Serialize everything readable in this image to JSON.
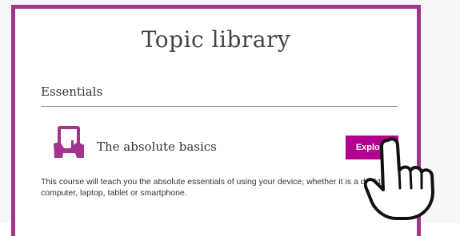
{
  "page": {
    "title": "Topic library"
  },
  "section": {
    "heading": "Essentials"
  },
  "course": {
    "title": "The absolute basics",
    "explore_label": "Explore",
    "description": "This course will teach you the absolute essentials of using your device, whether it is a desktop computer, laptop, tablet or smartphone.",
    "icon": "tablet-hands-icon"
  },
  "cursor": {
    "icon": "pointing-hand-cursor-icon"
  },
  "colors": {
    "brand": "#a2348c",
    "button": "#b3008f"
  }
}
